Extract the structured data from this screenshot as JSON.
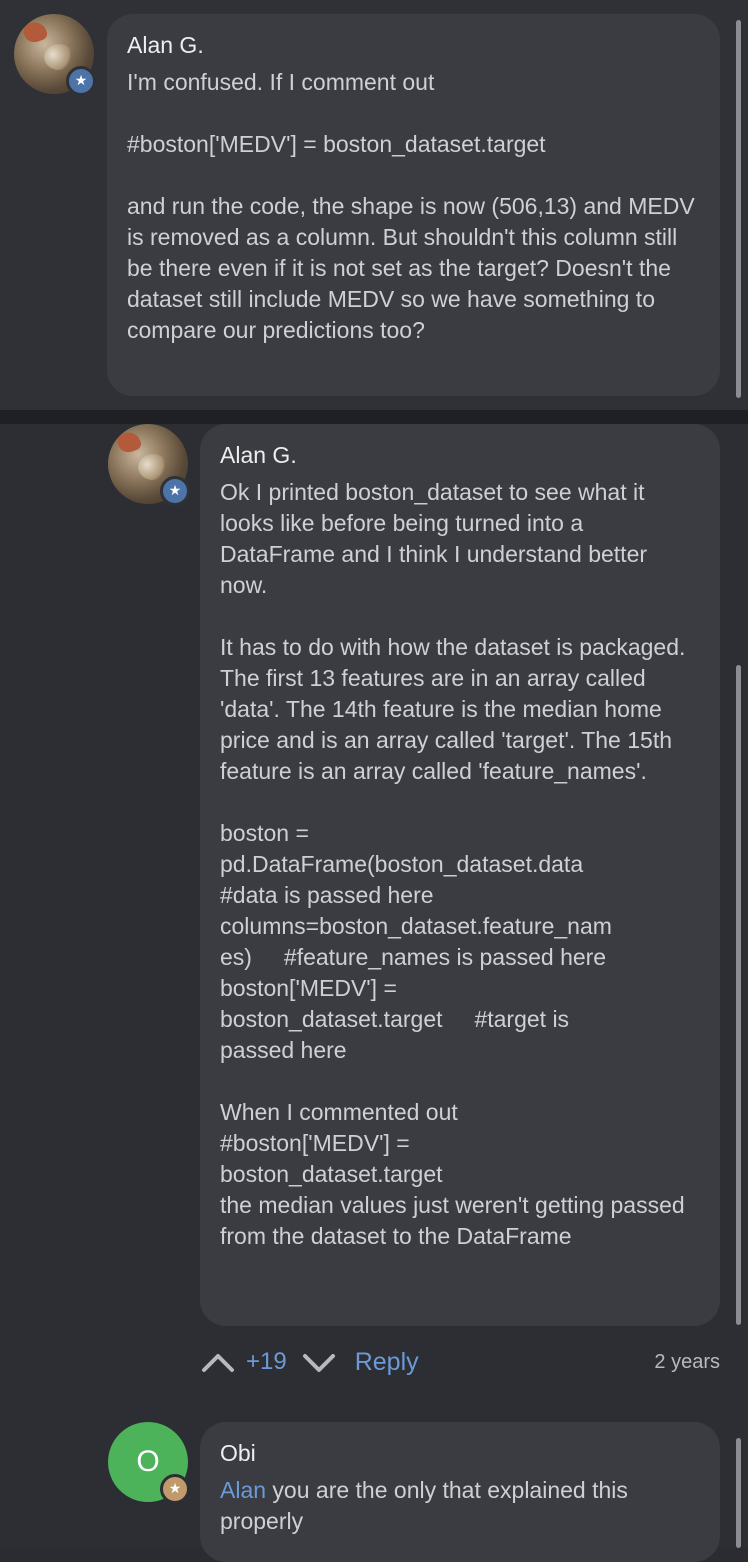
{
  "comments": [
    {
      "author": "Alan G.",
      "avatar_icon": "cat-photo-avatar",
      "badge_icon": "star-badge-icon",
      "text": "I'm confused. If I comment out\n\n#boston['MEDV'] = boston_dataset.target\n\nand run the code, the shape is now (506,13) and MEDV is removed as a column. But shouldn't this column still be there even if it is not set as the target? Doesn't the dataset still include MEDV so we have something to compare our predictions too?"
    },
    {
      "author": "Alan G.",
      "avatar_icon": "cat-photo-avatar",
      "badge_icon": "star-badge-icon",
      "text": "Ok I printed boston_dataset to see what it looks like before being turned into a DataFrame and I think I understand better now.\n\nIt has to do with how the dataset is packaged. The first 13 features are in an array called 'data'. The 14th feature is the median home price and is an array called 'target'. The 15th feature is an array called 'feature_names'.\n\nboston =\npd.DataFrame(boston_dataset.data\n#data is passed here\ncolumns=boston_dataset.feature_nam\nes)     #feature_names is passed here\nboston['MEDV'] =\nboston_dataset.target     #target is\npassed here\n\nWhen I commented out\n#boston['MEDV'] =\nboston_dataset.target\nthe median values just weren't getting passed from the dataset to the DataFrame",
      "votes": "+19",
      "reply_label": "Reply",
      "age": "2 years"
    },
    {
      "author": "Obi",
      "avatar_letter": "O",
      "badge_icon": "star-badge-icon",
      "mention": "Alan",
      "text": " you are the only that explained this properly"
    }
  ],
  "colors": {
    "accent": "#6c9ad6",
    "avatar_green": "#4db35a",
    "badge_blue": "#4d74a8",
    "badge_tan": "#c19a6b"
  }
}
